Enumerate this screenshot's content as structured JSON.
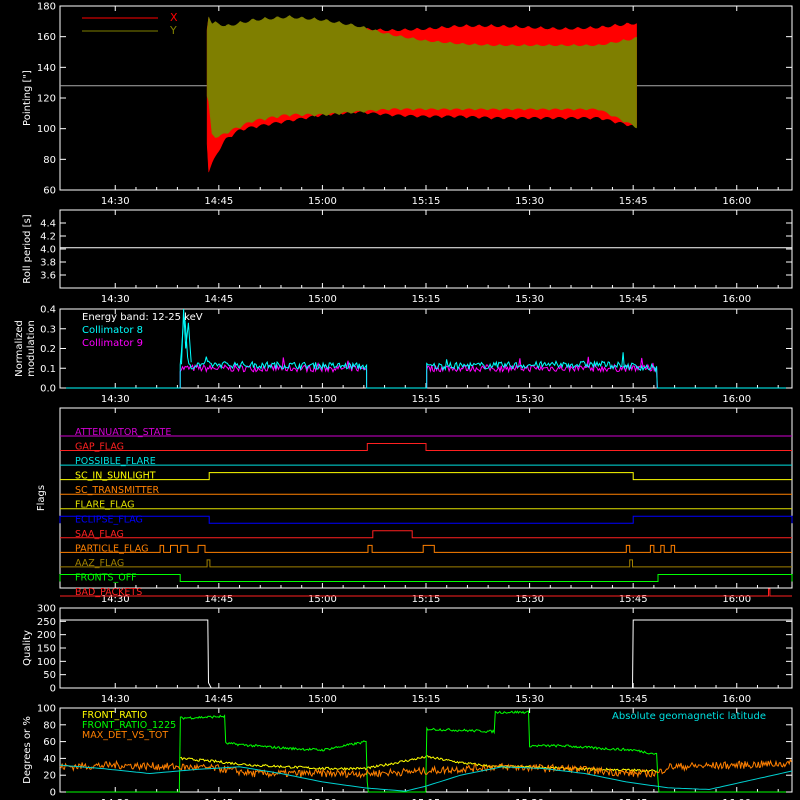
{
  "time_axis": {
    "ticks": [
      "14:30",
      "14:45",
      "15:00",
      "15:15",
      "15:30",
      "15:45",
      "16:00"
    ],
    "tick_minutes": [
      870,
      885,
      900,
      915,
      930,
      945,
      960
    ],
    "range_minutes": [
      862,
      968
    ]
  },
  "chart_data": [
    {
      "type": "area",
      "ylabel": "Pointing [\"]",
      "ylim": [
        60,
        180
      ],
      "yticks": [
        "60",
        "80",
        "100",
        "120",
        "140",
        "160",
        "180"
      ],
      "yticks_values": [
        60,
        80,
        100,
        120,
        140,
        160,
        180
      ],
      "legend": [
        "X",
        "Y"
      ],
      "legend_placement": "top-left",
      "reference_line": 128,
      "series": [
        {
          "name": "X",
          "color": "#ff0000",
          "x": [
            883.3,
            883.5,
            884,
            885,
            886,
            888,
            890,
            895,
            900,
            905,
            910,
            915,
            920,
            925,
            930,
            935,
            940,
            945.5
          ],
          "upper": [
            165,
            174,
            170,
            163,
            160,
            165,
            168,
            166,
            168,
            166,
            165,
            166,
            168,
            168,
            167,
            166,
            167,
            170
          ],
          "lower": [
            90,
            70,
            75,
            85,
            92,
            98,
            100,
            104,
            108,
            110,
            108,
            107,
            107,
            106,
            106,
            106,
            106,
            100
          ]
        },
        {
          "name": "Y",
          "color": "#7f7f00",
          "x": [
            883.3,
            883.5,
            884,
            885,
            886,
            888,
            890,
            895,
            900,
            905,
            910,
            915,
            920,
            925,
            930,
            935,
            940,
            945.5
          ],
          "upper": [
            165,
            175,
            170,
            170,
            168,
            170,
            172,
            174,
            172,
            168,
            162,
            158,
            156,
            155,
            155,
            155,
            155,
            160
          ],
          "lower": [
            120,
            118,
            95,
            93,
            96,
            100,
            104,
            108,
            108,
            110,
            112,
            112,
            112,
            112,
            112,
            112,
            112,
            100
          ]
        }
      ]
    },
    {
      "type": "line",
      "ylabel": "Roll period [s]",
      "ylim": [
        3.4,
        4.6
      ],
      "yticks": [
        "3.6",
        "3.8",
        "4.0",
        "4.2",
        "4.4"
      ],
      "yticks_values": [
        3.6,
        3.8,
        4.0,
        4.2,
        4.4
      ],
      "series": [
        {
          "name": "",
          "color": "#ffffff",
          "x": [
            862,
            968
          ],
          "values": [
            4.02,
            4.02
          ]
        }
      ]
    },
    {
      "type": "line",
      "ylabel": "Normalized modulation",
      "ylabel_lines": [
        "Normalized",
        "modulation"
      ],
      "ylim": [
        0,
        0.4
      ],
      "yticks": [
        "0.0",
        "0.1",
        "0.2",
        "0.3",
        "0.4"
      ],
      "yticks_values": [
        0,
        0.1,
        0.2,
        0.3,
        0.4
      ],
      "annotation": "Energy band: 12-25 keV",
      "legend": [
        "Collimator 8",
        "Collimator 9"
      ],
      "series": [
        {
          "name": "Collimator 8",
          "color": "#00ffff",
          "x": [
            862,
            879.3,
            879.4,
            880,
            880.5,
            881,
            882,
            906.4,
            906.5,
            915,
            915.1,
            940,
            945,
            948.5,
            948.6,
            968
          ],
          "values": [
            0,
            0,
            0.12,
            0.38,
            0.14,
            0.11,
            0.12,
            0.11,
            0,
            0,
            0.11,
            0.12,
            0.11,
            0.1,
            0,
            0
          ]
        },
        {
          "name": "Collimator 9",
          "color": "#ff00ff",
          "x": [
            862,
            879.3,
            879.4,
            906.4,
            906.5,
            915,
            915.1,
            948.5,
            948.6,
            968
          ],
          "values": [
            0,
            0,
            0.1,
            0.1,
            0,
            0,
            0.1,
            0.1,
            0,
            0
          ]
        }
      ]
    },
    {
      "type": "line",
      "ylabel": "Flags",
      "series": [
        {
          "name": "ATTENUATOR_STATE",
          "color": "#d000d0",
          "steps": []
        },
        {
          "name": "GAP_FLAG",
          "color": "#ff2020",
          "steps": [
            [
              906.5,
              915
            ]
          ]
        },
        {
          "name": "POSSIBLE_FLARE",
          "color": "#00e0e0",
          "steps": []
        },
        {
          "name": "SC_IN_SUNLIGHT",
          "color": "#ffff00",
          "steps": [
            [
              883.6,
              945
            ]
          ]
        },
        {
          "name": "SC_TRANSMITTER",
          "color": "#ff8000",
          "steps": []
        },
        {
          "name": "FLARE_FLAG",
          "color": "#e0e000",
          "steps": []
        },
        {
          "name": "ECLIPSE_FLAG",
          "color": "#0000ff",
          "steps": [
            [
              862,
              883.6
            ],
            [
              945,
              968
            ]
          ]
        },
        {
          "name": "SAA_FLAG",
          "color": "#ff2020",
          "steps": [
            [
              907.3,
              913
            ]
          ]
        },
        {
          "name": "PARTICLE_FLAG",
          "color": "#ff8000",
          "steps": [
            [
              876.5,
              877
            ],
            [
              878,
              879
            ],
            [
              879.5,
              880.5
            ],
            [
              882,
              883
            ],
            [
              906.6,
              907.2
            ],
            [
              914.6,
              916.2
            ],
            [
              944,
              944.5
            ],
            [
              947.5,
              948
            ],
            [
              949,
              949.5
            ],
            [
              950.5,
              951
            ]
          ]
        },
        {
          "name": "AAZ_FLAG",
          "color": "#a08000",
          "steps": [
            [
              883.3,
              883.7
            ],
            [
              944.5,
              944.9
            ]
          ]
        },
        {
          "name": "FRONTS_OFF",
          "color": "#00ff00",
          "steps": [
            [
              862,
              879.4
            ],
            [
              948.6,
              968
            ]
          ]
        },
        {
          "name": "BAD_PACKETS",
          "color": "#ff2020",
          "steps": [
            [
              964.6,
              964.8
            ]
          ]
        }
      ]
    },
    {
      "type": "line",
      "ylabel": "Quality",
      "ylim": [
        0,
        300
      ],
      "yticks": [
        "0",
        "50",
        "100",
        "150",
        "200",
        "250",
        "300"
      ],
      "yticks_values": [
        0,
        50,
        100,
        150,
        200,
        250,
        300
      ],
      "series": [
        {
          "name": "",
          "color": "#ffffff",
          "x": [
            862,
            883.4,
            883.5,
            883.9,
            884,
            944.9,
            945,
            968
          ],
          "values": [
            255,
            255,
            20,
            0,
            0,
            0,
            255,
            255
          ]
        }
      ]
    },
    {
      "type": "line",
      "ylabel": "Degrees or %",
      "ylim": [
        0,
        100
      ],
      "yticks": [
        "0",
        "20",
        "40",
        "60",
        "80",
        "100"
      ],
      "yticks_values": [
        0,
        20,
        40,
        60,
        80,
        100
      ],
      "legend": [
        "FRONT_RATIO",
        "FRONT_RATIO_1225",
        "MAX_DET_VS_TOT"
      ],
      "annotation": "Absolute geomagnetic latitude",
      "series": [
        {
          "name": "FRONT_RATIO",
          "color": "#ffff00",
          "x": [
            879.4,
            885,
            886,
            890,
            895,
            900,
            906.4,
            915.1,
            920,
            925,
            930,
            935,
            940,
            948.5
          ],
          "values": [
            40,
            36,
            35,
            32,
            30,
            28,
            28,
            42,
            35,
            30,
            30,
            28,
            27,
            25
          ]
        },
        {
          "name": "FRONT_RATIO_1225",
          "color": "#00ff00",
          "x": [
            862,
            879.3,
            879.4,
            885.9,
            886,
            890,
            895,
            900,
            906.4,
            906.5,
            915,
            915.1,
            924.9,
            925,
            929.9,
            930,
            935,
            940,
            945,
            948.5,
            948.6,
            968
          ],
          "values": [
            0,
            0,
            88,
            90,
            58,
            55,
            52,
            50,
            60,
            0,
            0,
            75,
            72,
            95,
            95,
            55,
            55,
            52,
            50,
            45,
            0,
            0
          ]
        },
        {
          "name": "MAX_DET_VS_TOT",
          "color": "#ff8000",
          "x": [
            862,
            870,
            879,
            885,
            890,
            900,
            906.4,
            915.1,
            925,
            935,
            945,
            948.5,
            950,
            960,
            968
          ],
          "values": [
            30,
            32,
            30,
            28,
            22,
            22,
            22,
            25,
            30,
            28,
            22,
            22,
            30,
            32,
            34
          ]
        },
        {
          "name": "Absolute geomagnetic latitude",
          "color": "#00d0d0",
          "x": [
            862,
            868,
            875,
            882,
            888,
            894,
            900,
            906,
            912,
            915,
            920,
            926,
            932,
            938,
            944,
            950,
            956,
            962,
            968
          ],
          "values": [
            32,
            28,
            22,
            27,
            30,
            22,
            12,
            5,
            1,
            7,
            20,
            30,
            28,
            22,
            12,
            5,
            3,
            14,
            25
          ]
        }
      ]
    }
  ]
}
